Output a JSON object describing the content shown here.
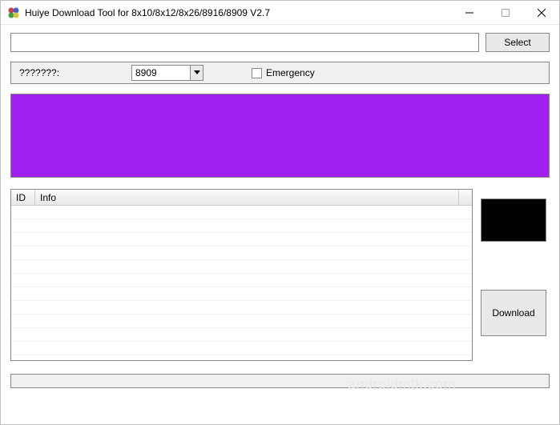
{
  "window": {
    "title": "Huiye Download Tool for 8x10/8x12/8x26/8916/8909 V2.7"
  },
  "top": {
    "path_value": "",
    "select_label": "Select"
  },
  "options": {
    "label": "???????:",
    "combo_value": "8909",
    "emergency_label": "Emergency",
    "emergency_checked": false
  },
  "table": {
    "columns": {
      "id": "ID",
      "info": "Info"
    },
    "rows": []
  },
  "actions": {
    "download_label": "Download"
  },
  "watermark": "androidmtk.com"
}
